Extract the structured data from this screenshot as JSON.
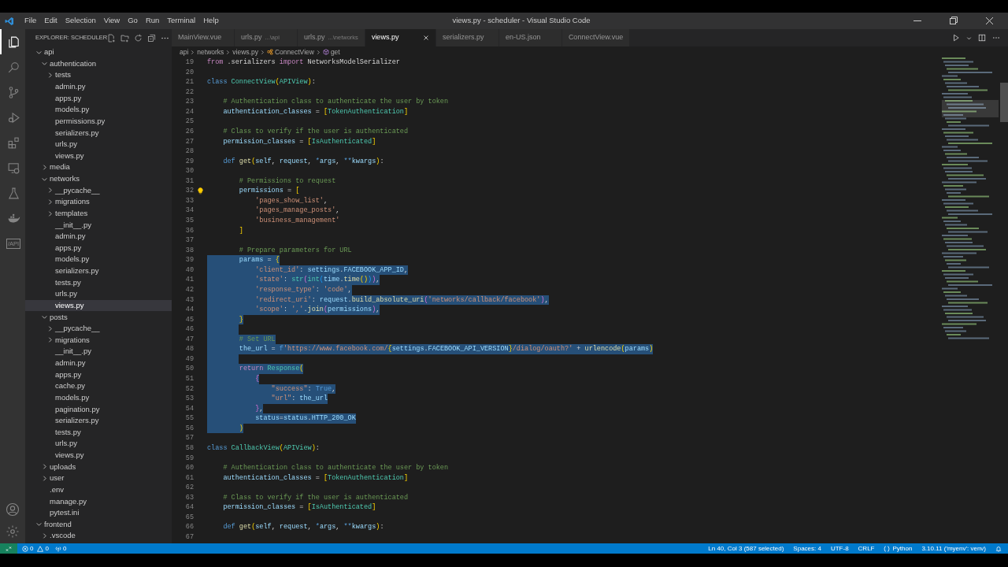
{
  "window": {
    "title": "views.py - scheduler - Visual Studio Code"
  },
  "menu": [
    "File",
    "Edit",
    "Selection",
    "View",
    "Go",
    "Run",
    "Terminal",
    "Help"
  ],
  "activity_bar": {
    "items": [
      {
        "kind": "files",
        "selected": true
      },
      {
        "kind": "search",
        "selected": false
      },
      {
        "kind": "source-control",
        "selected": false
      },
      {
        "kind": "run-debug",
        "selected": false
      },
      {
        "kind": "extensions",
        "selected": false
      },
      {
        "kind": "remote",
        "selected": false
      },
      {
        "kind": "testing",
        "selected": false
      },
      {
        "kind": "docker",
        "selected": false
      },
      {
        "kind": "api",
        "selected": false,
        "label": "/API"
      }
    ]
  },
  "explorer": {
    "title": "EXPLORER: SCHEDULER",
    "tree": [
      {
        "label": "api",
        "kind": "folder",
        "expanded": true,
        "selected": false,
        "children": [
          {
            "label": "authentication",
            "kind": "folder",
            "expanded": true,
            "selected": false,
            "children": [
              {
                "label": "tests",
                "kind": "folder",
                "expanded": false,
                "selected": false
              },
              {
                "label": "admin.py",
                "kind": "file",
                "selected": false
              },
              {
                "label": "apps.py",
                "kind": "file",
                "selected": false
              },
              {
                "label": "models.py",
                "kind": "file",
                "selected": false
              },
              {
                "label": "permissions.py",
                "kind": "file",
                "selected": false
              },
              {
                "label": "serializers.py",
                "kind": "file",
                "selected": false
              },
              {
                "label": "urls.py",
                "kind": "file",
                "selected": false
              },
              {
                "label": "views.py",
                "kind": "file",
                "selected": false
              }
            ]
          },
          {
            "label": "media",
            "kind": "folder",
            "expanded": false,
            "selected": false
          },
          {
            "label": "networks",
            "kind": "folder",
            "expanded": true,
            "selected": false,
            "children": [
              {
                "label": "__pycache__",
                "kind": "folder",
                "expanded": false,
                "selected": false
              },
              {
                "label": "migrations",
                "kind": "folder",
                "expanded": false,
                "selected": false
              },
              {
                "label": "templates",
                "kind": "folder",
                "expanded": false,
                "selected": false
              },
              {
                "label": "__init__.py",
                "kind": "file",
                "selected": false
              },
              {
                "label": "admin.py",
                "kind": "file",
                "selected": false
              },
              {
                "label": "apps.py",
                "kind": "file",
                "selected": false
              },
              {
                "label": "models.py",
                "kind": "file",
                "selected": false
              },
              {
                "label": "serializers.py",
                "kind": "file",
                "selected": false
              },
              {
                "label": "tests.py",
                "kind": "file",
                "selected": false
              },
              {
                "label": "urls.py",
                "kind": "file",
                "selected": false
              },
              {
                "label": "views.py",
                "kind": "file",
                "selected": true
              }
            ]
          },
          {
            "label": "posts",
            "kind": "folder",
            "expanded": true,
            "selected": false,
            "children": [
              {
                "label": "__pycache__",
                "kind": "folder",
                "expanded": false,
                "selected": false
              },
              {
                "label": "migrations",
                "kind": "folder",
                "expanded": false,
                "selected": false
              },
              {
                "label": "__init__.py",
                "kind": "file",
                "selected": false
              },
              {
                "label": "admin.py",
                "kind": "file",
                "selected": false
              },
              {
                "label": "apps.py",
                "kind": "file",
                "selected": false
              },
              {
                "label": "cache.py",
                "kind": "file",
                "selected": false
              },
              {
                "label": "models.py",
                "kind": "file",
                "selected": false
              },
              {
                "label": "pagination.py",
                "kind": "file",
                "selected": false
              },
              {
                "label": "serializers.py",
                "kind": "file",
                "selected": false
              },
              {
                "label": "tests.py",
                "kind": "file",
                "selected": false
              },
              {
                "label": "urls.py",
                "kind": "file",
                "selected": false
              },
              {
                "label": "views.py",
                "kind": "file",
                "selected": false
              }
            ]
          },
          {
            "label": "uploads",
            "kind": "folder",
            "expanded": false,
            "selected": false
          },
          {
            "label": "user",
            "kind": "folder",
            "expanded": false,
            "selected": false
          },
          {
            "label": ".env",
            "kind": "file",
            "selected": false
          },
          {
            "label": "manage.py",
            "kind": "file",
            "selected": false
          },
          {
            "label": "pytest.ini",
            "kind": "file",
            "selected": false
          }
        ]
      },
      {
        "label": "frontend",
        "kind": "folder",
        "expanded": true,
        "selected": false,
        "children": [
          {
            "label": ".vscode",
            "kind": "folder",
            "expanded": false,
            "selected": false
          }
        ]
      }
    ]
  },
  "tabs": [
    {
      "label": "MainView.vue",
      "selected": false
    },
    {
      "label": "urls.py",
      "description": "...\\api",
      "selected": false
    },
    {
      "label": "urls.py",
      "description": "...\\networks",
      "selected": false
    },
    {
      "label": "views.py",
      "selected": true
    },
    {
      "label": "serializers.py",
      "selected": false
    },
    {
      "label": "en-US.json",
      "selected": false
    },
    {
      "label": "ConnectView.vue",
      "selected": false
    }
  ],
  "breadcrumb": [
    {
      "label": "api",
      "kind": "folder"
    },
    {
      "label": "networks",
      "kind": "folder"
    },
    {
      "label": "views.py",
      "kind": "file"
    },
    {
      "label": "ConnectView",
      "kind": "class"
    },
    {
      "label": "get",
      "kind": "method"
    }
  ],
  "editor": {
    "lines": [
      {
        "number": "19",
        "selected": false,
        "tokens": [
          {
            "kind": "ctl",
            "text": "from"
          },
          {
            "kind": "p",
            "text": " .serializers "
          },
          {
            "kind": "ctl",
            "text": "import"
          },
          {
            "kind": "p",
            "text": " NetworksModelSerializer"
          }
        ]
      },
      {
        "number": "20",
        "selected": false
      },
      {
        "number": "21",
        "selected": false,
        "tokens": [
          {
            "kind": "kw",
            "text": "class "
          },
          {
            "kind": "cls",
            "text": "ConnectView"
          },
          {
            "kind": "b1",
            "text": "("
          },
          {
            "kind": "cls",
            "text": "APIView"
          },
          {
            "kind": "b1",
            "text": ")"
          },
          {
            "kind": "p",
            "text": ":"
          }
        ]
      },
      {
        "number": "22",
        "selected": false
      },
      {
        "number": "23",
        "selected": false,
        "tokens": [
          {
            "kind": "cmt",
            "text": "    # Authentication class to authenticate the user by token"
          }
        ]
      },
      {
        "number": "24",
        "selected": false,
        "tokens": [
          {
            "kind": "var",
            "text": "    authentication_classes"
          },
          {
            "kind": "p",
            "text": " = "
          },
          {
            "kind": "b1",
            "text": "["
          },
          {
            "kind": "cls",
            "text": "TokenAuthentication"
          },
          {
            "kind": "b1",
            "text": "]"
          }
        ]
      },
      {
        "number": "25",
        "selected": false
      },
      {
        "number": "26",
        "selected": false,
        "tokens": [
          {
            "kind": "cmt",
            "text": "    # Class to verify if the user is authenticated"
          }
        ]
      },
      {
        "number": "27",
        "selected": false,
        "tokens": [
          {
            "kind": "var",
            "text": "    permission_classes"
          },
          {
            "kind": "p",
            "text": " = "
          },
          {
            "kind": "b1",
            "text": "["
          },
          {
            "kind": "cls",
            "text": "IsAuthenticated"
          },
          {
            "kind": "b1",
            "text": "]"
          }
        ]
      },
      {
        "number": "28",
        "selected": false
      },
      {
        "number": "29",
        "selected": false,
        "tokens": [
          {
            "kind": "kw",
            "text": "    def "
          },
          {
            "kind": "fn",
            "text": "get"
          },
          {
            "kind": "b1",
            "text": "("
          },
          {
            "kind": "var",
            "text": "self"
          },
          {
            "kind": "p",
            "text": ", "
          },
          {
            "kind": "var",
            "text": "request"
          },
          {
            "kind": "p",
            "text": ", "
          },
          {
            "kind": "kw",
            "text": "*"
          },
          {
            "kind": "var",
            "text": "args"
          },
          {
            "kind": "p",
            "text": ", "
          },
          {
            "kind": "kw",
            "text": "**"
          },
          {
            "kind": "var",
            "text": "kwargs"
          },
          {
            "kind": "b1",
            "text": ")"
          },
          {
            "kind": "p",
            "text": ":"
          }
        ]
      },
      {
        "number": "30",
        "selected": false
      },
      {
        "number": "31",
        "selected": false,
        "tokens": [
          {
            "kind": "cmt",
            "text": "        # Permissions to request"
          }
        ]
      },
      {
        "number": "32",
        "selected": false,
        "hint": true,
        "tokens": [
          {
            "kind": "var",
            "text": "        permissions"
          },
          {
            "kind": "p",
            "text": " = "
          },
          {
            "kind": "b1",
            "text": "["
          }
        ]
      },
      {
        "number": "33",
        "selected": false,
        "tokens": [
          {
            "kind": "str",
            "text": "            'pages_show_list'"
          },
          {
            "kind": "p",
            "text": ","
          }
        ]
      },
      {
        "number": "34",
        "selected": false,
        "tokens": [
          {
            "kind": "str",
            "text": "            'pages_manage_posts'"
          },
          {
            "kind": "p",
            "text": ","
          }
        ]
      },
      {
        "number": "35",
        "selected": false,
        "tokens": [
          {
            "kind": "str",
            "text": "            'business_management'"
          }
        ]
      },
      {
        "number": "36",
        "selected": false,
        "tokens": [
          {
            "kind": "b1",
            "text": "        ]"
          }
        ]
      },
      {
        "number": "37",
        "selected": false
      },
      {
        "number": "38",
        "selected": false,
        "tokens": [
          {
            "kind": "cmt",
            "text": "        # Prepare parameters for URL"
          }
        ]
      },
      {
        "number": "39",
        "selected": true,
        "tokens": [
          {
            "kind": "var",
            "text": "        params"
          },
          {
            "kind": "p",
            "text": " = "
          },
          {
            "kind": "b1",
            "text": "{"
          }
        ]
      },
      {
        "number": "40",
        "selected": true,
        "tokens": [
          {
            "kind": "str",
            "text": "            'client_id'"
          },
          {
            "kind": "p",
            "text": ": "
          },
          {
            "kind": "var",
            "text": "settings"
          },
          {
            "kind": "p",
            "text": "."
          },
          {
            "kind": "var",
            "text": "FACEBOOK_APP_ID"
          },
          {
            "kind": "p",
            "text": ","
          }
        ]
      },
      {
        "number": "41",
        "selected": true,
        "tokens": [
          {
            "kind": "str",
            "text": "            'state'"
          },
          {
            "kind": "p",
            "text": ": "
          },
          {
            "kind": "cls",
            "text": "str"
          },
          {
            "kind": "b2",
            "text": "("
          },
          {
            "kind": "cls",
            "text": "int"
          },
          {
            "kind": "b3",
            "text": "("
          },
          {
            "kind": "var",
            "text": "time"
          },
          {
            "kind": "p",
            "text": "."
          },
          {
            "kind": "fn",
            "text": "time"
          },
          {
            "kind": "b1",
            "text": "()"
          },
          {
            "kind": "b3",
            "text": ")"
          },
          {
            "kind": "b2",
            "text": ")"
          },
          {
            "kind": "p",
            "text": ","
          }
        ]
      },
      {
        "number": "42",
        "selected": true,
        "tokens": [
          {
            "kind": "str",
            "text": "            'response_type'"
          },
          {
            "kind": "p",
            "text": ": "
          },
          {
            "kind": "str",
            "text": "'code'"
          },
          {
            "kind": "p",
            "text": ","
          }
        ]
      },
      {
        "number": "43",
        "selected": true,
        "tokens": [
          {
            "kind": "str",
            "text": "            'redirect_uri'"
          },
          {
            "kind": "p",
            "text": ": "
          },
          {
            "kind": "var",
            "text": "request"
          },
          {
            "kind": "p",
            "text": "."
          },
          {
            "kind": "fn",
            "text": "build_absolute_uri"
          },
          {
            "kind": "b2",
            "text": "("
          },
          {
            "kind": "str",
            "text": "'networks/callback/facebook'"
          },
          {
            "kind": "b2",
            "text": ")"
          },
          {
            "kind": "p",
            "text": ","
          }
        ]
      },
      {
        "number": "44",
        "selected": true,
        "tokens": [
          {
            "kind": "str",
            "text": "            'scope'"
          },
          {
            "kind": "p",
            "text": ": "
          },
          {
            "kind": "str",
            "text": "','"
          },
          {
            "kind": "p",
            "text": "."
          },
          {
            "kind": "fn",
            "text": "join"
          },
          {
            "kind": "b2",
            "text": "("
          },
          {
            "kind": "var",
            "text": "permissions"
          },
          {
            "kind": "b2",
            "text": ")"
          },
          {
            "kind": "p",
            "text": ","
          }
        ]
      },
      {
        "number": "45",
        "selected": true,
        "tokens": [
          {
            "kind": "b1",
            "text": "        }"
          }
        ]
      },
      {
        "number": "46",
        "selected": true
      },
      {
        "number": "47",
        "selected": true,
        "tokens": [
          {
            "kind": "cmt",
            "text": "        # Set URL"
          }
        ]
      },
      {
        "number": "48",
        "selected": true,
        "tokens": [
          {
            "kind": "var",
            "text": "        the_url"
          },
          {
            "kind": "p",
            "text": " = "
          },
          {
            "kind": "kw",
            "text": "f"
          },
          {
            "kind": "str",
            "text": "'https://www.facebook.com/"
          },
          {
            "kind": "b1",
            "text": "{"
          },
          {
            "kind": "var",
            "text": "settings"
          },
          {
            "kind": "p",
            "text": "."
          },
          {
            "kind": "var",
            "text": "FACEBOOK_API_VERSION"
          },
          {
            "kind": "b1",
            "text": "}"
          },
          {
            "kind": "str",
            "text": "/dialog/oauth?'"
          },
          {
            "kind": "p",
            "text": " + "
          },
          {
            "kind": "fn",
            "text": "urlencode"
          },
          {
            "kind": "b1",
            "text": "("
          },
          {
            "kind": "var",
            "text": "params"
          },
          {
            "kind": "b1",
            "text": ")"
          }
        ]
      },
      {
        "number": "49",
        "selected": true
      },
      {
        "number": "50",
        "selected": true,
        "tokens": [
          {
            "kind": "ctl",
            "text": "        return "
          },
          {
            "kind": "cls",
            "text": "Response"
          },
          {
            "kind": "b1",
            "text": "("
          }
        ]
      },
      {
        "number": "51",
        "selected": true,
        "tokens": [
          {
            "kind": "b2",
            "text": "            {"
          }
        ]
      },
      {
        "number": "52",
        "selected": true,
        "tokens": [
          {
            "kind": "str",
            "text": "                \"success\""
          },
          {
            "kind": "p",
            "text": ": "
          },
          {
            "kind": "kw",
            "text": "True"
          },
          {
            "kind": "p",
            "text": ","
          }
        ]
      },
      {
        "number": "53",
        "selected": true,
        "tokens": [
          {
            "kind": "str",
            "text": "                \"url\""
          },
          {
            "kind": "p",
            "text": ": "
          },
          {
            "kind": "var",
            "text": "the_url"
          }
        ]
      },
      {
        "number": "54",
        "selected": true,
        "tokens": [
          {
            "kind": "b2",
            "text": "            }"
          },
          {
            "kind": "p",
            "text": ","
          }
        ]
      },
      {
        "number": "55",
        "selected": true,
        "tokens": [
          {
            "kind": "var",
            "text": "            status"
          },
          {
            "kind": "p",
            "text": "="
          },
          {
            "kind": "var",
            "text": "status"
          },
          {
            "kind": "p",
            "text": "."
          },
          {
            "kind": "var",
            "text": "HTTP_200_OK"
          }
        ]
      },
      {
        "number": "56",
        "selected": true,
        "tokens": [
          {
            "kind": "b1",
            "text": "        )"
          }
        ]
      },
      {
        "number": "57",
        "selected": false
      },
      {
        "number": "58",
        "selected": false,
        "tokens": [
          {
            "kind": "kw",
            "text": "class "
          },
          {
            "kind": "cls",
            "text": "CallbackView"
          },
          {
            "kind": "b1",
            "text": "("
          },
          {
            "kind": "cls",
            "text": "APIView"
          },
          {
            "kind": "b1",
            "text": ")"
          },
          {
            "kind": "p",
            "text": ":"
          }
        ]
      },
      {
        "number": "59",
        "selected": false
      },
      {
        "number": "60",
        "selected": false,
        "tokens": [
          {
            "kind": "cmt",
            "text": "    # Authentication class to authenticate the user by token"
          }
        ]
      },
      {
        "number": "61",
        "selected": false,
        "tokens": [
          {
            "kind": "var",
            "text": "    authentication_classes"
          },
          {
            "kind": "p",
            "text": " = "
          },
          {
            "kind": "b1",
            "text": "["
          },
          {
            "kind": "cls",
            "text": "TokenAuthentication"
          },
          {
            "kind": "b1",
            "text": "]"
          }
        ]
      },
      {
        "number": "62",
        "selected": false
      },
      {
        "number": "63",
        "selected": false,
        "tokens": [
          {
            "kind": "cmt",
            "text": "    # Class to verify if the user is authenticated"
          }
        ]
      },
      {
        "number": "64",
        "selected": false,
        "tokens": [
          {
            "kind": "var",
            "text": "    permission_classes"
          },
          {
            "kind": "p",
            "text": " = "
          },
          {
            "kind": "b1",
            "text": "["
          },
          {
            "kind": "cls",
            "text": "IsAuthenticated"
          },
          {
            "kind": "b1",
            "text": "]"
          }
        ]
      },
      {
        "number": "65",
        "selected": false
      },
      {
        "number": "66",
        "selected": false,
        "tokens": [
          {
            "kind": "kw",
            "text": "    def "
          },
          {
            "kind": "fn",
            "text": "get"
          },
          {
            "kind": "b1",
            "text": "("
          },
          {
            "kind": "var",
            "text": "self"
          },
          {
            "kind": "p",
            "text": ", "
          },
          {
            "kind": "var",
            "text": "request"
          },
          {
            "kind": "p",
            "text": ", "
          },
          {
            "kind": "kw",
            "text": "*"
          },
          {
            "kind": "var",
            "text": "args"
          },
          {
            "kind": "p",
            "text": ", "
          },
          {
            "kind": "kw",
            "text": "**"
          },
          {
            "kind": "var",
            "text": "kwargs"
          },
          {
            "kind": "b1",
            "text": ")"
          },
          {
            "kind": "p",
            "text": ":"
          }
        ]
      },
      {
        "number": "67",
        "selected": false
      }
    ]
  },
  "status_bar": {
    "errors": "0",
    "warnings": "0",
    "ports": "0",
    "position": "Ln 40, Col 3 (587 selected)",
    "indent": "Spaces: 4",
    "encoding": "UTF-8",
    "eol": "CRLF",
    "language": "Python",
    "interpreter": "3.10.11 ('myenv': venv)"
  }
}
